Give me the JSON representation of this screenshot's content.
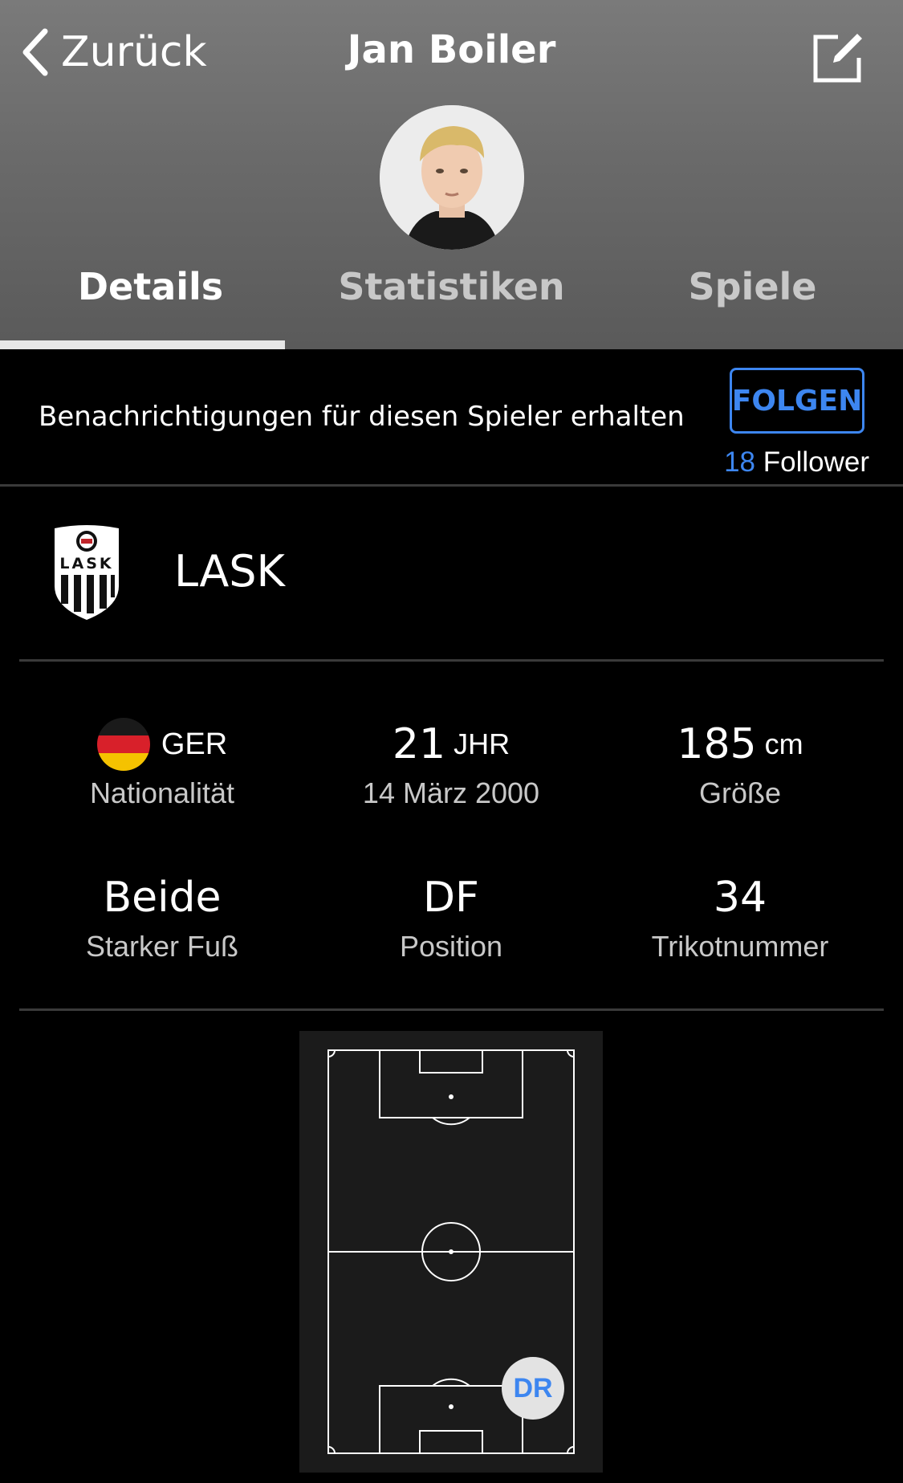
{
  "header": {
    "back_label": "Zurück",
    "title": "Jan Boiler"
  },
  "tabs": [
    {
      "label": "Details",
      "active": true
    },
    {
      "label": "Statistiken",
      "active": false
    },
    {
      "label": "Spiele",
      "active": false
    }
  ],
  "follow": {
    "text": "Benachrichtigungen für diesen Spieler erhalten",
    "button_label": "FOLGEN",
    "follower_count": "18",
    "follower_label": "Follower"
  },
  "club": {
    "name": "LASK",
    "logo_text": "LASK"
  },
  "stats": {
    "nationality": {
      "value": "GER",
      "label": "Nationalität"
    },
    "age": {
      "value": "21",
      "unit": "JHR",
      "label": "14 März 2000"
    },
    "height": {
      "value": "185",
      "unit": "cm",
      "label": "Größe"
    },
    "foot": {
      "value": "Beide",
      "label": "Starker Fuß"
    },
    "position": {
      "value": "DF",
      "label": "Position"
    },
    "shirt": {
      "value": "34",
      "label": "Trikotnummer"
    }
  },
  "pitch": {
    "position_badge": "DR"
  },
  "colors": {
    "accent": "#3d86f0",
    "background": "#000000",
    "header": "#6e6e6e"
  }
}
